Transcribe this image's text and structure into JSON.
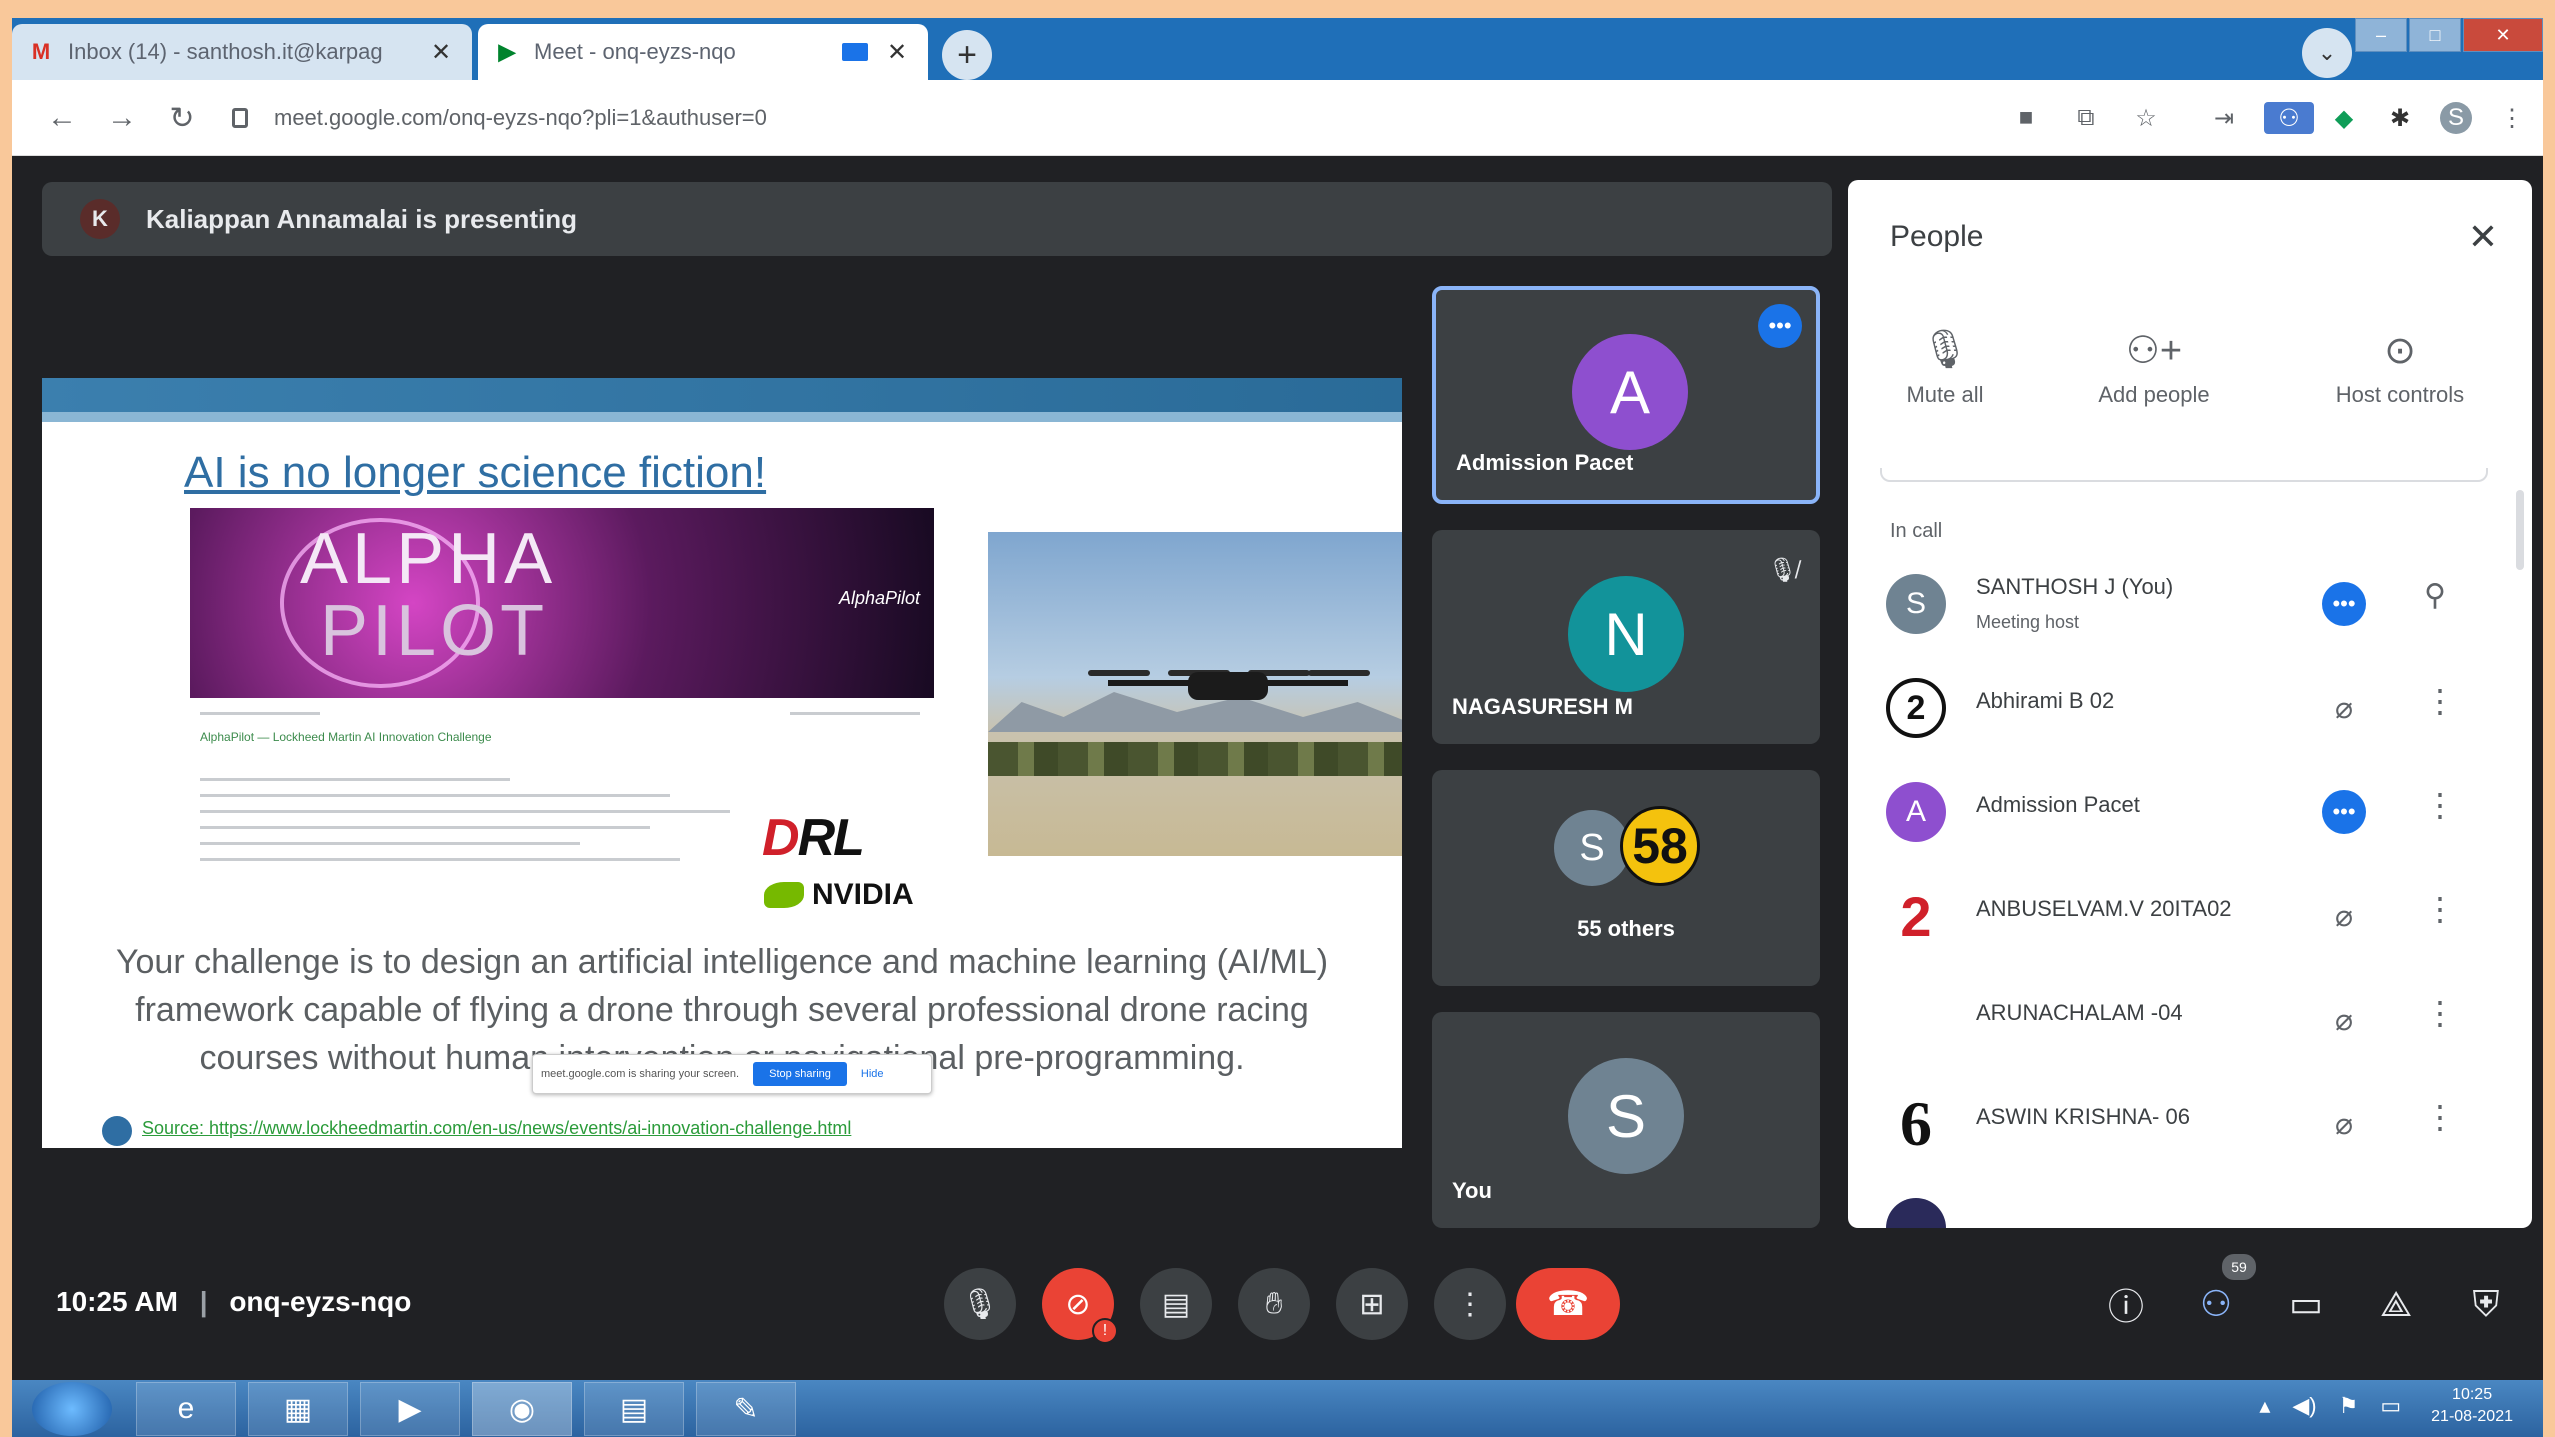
{
  "browser": {
    "tabs": [
      {
        "title": "Inbox (14) - santhosh.it@karpag",
        "favicon": "gmail-icon"
      },
      {
        "title": "Meet - onq-eyzs-nqo",
        "favicon": "meet-icon"
      }
    ],
    "url": "meet.google.com/onq-eyzs-nqo?pli=1&authuser=0"
  },
  "meet": {
    "presenter_initial": "K",
    "presenting_text": "Kaliappan Annamalai is presenting",
    "slide": {
      "title": "AI is no longer science fiction!",
      "alpha_line1": "ALPHA",
      "alpha_line2": "PILOT",
      "alpha_logo": "AlphaPilot",
      "article_heading": "AlphaPilot — Lockheed Martin AI Innovation Challenge",
      "drl_a": "D",
      "drl_b": "RL",
      "nvidia": "NVIDIA",
      "body": "Your challenge is to design an artificial intelligence and machine learning (AI/ML) framework capable of flying a drone through several professional drone racing courses without human intervention or navigational pre-programming.",
      "share_text": "meet.google.com is sharing your screen.",
      "stop_sharing": "Stop sharing",
      "hide": "Hide",
      "source": "Source: https://www.lockheedmartin.com/en-us/news/events/ai-innovation-challenge.html"
    },
    "tiles": [
      {
        "initial": "A",
        "name": "Admission Pacet",
        "color": "#8e4fcf"
      },
      {
        "initial": "N",
        "name": "NAGASURESH M",
        "color": "#12939a"
      },
      {
        "initial": "S",
        "badge": "58",
        "label": "55 others"
      },
      {
        "initial": "S",
        "name": "You",
        "color": "#6f8392"
      }
    ],
    "people": {
      "title": "People",
      "actions": [
        {
          "label": "Mute all",
          "icon": "mic-off-icon"
        },
        {
          "label": "Add people",
          "icon": "add-person-icon"
        },
        {
          "label": "Host controls",
          "icon": "host-controls-icon"
        }
      ],
      "section": "In call",
      "rows": [
        {
          "avatar": "S",
          "avatar_color": "#6f8392",
          "name": "SANTHOSH J (You)",
          "sub": "Meeting host",
          "status": "speaking"
        },
        {
          "avatar": "2",
          "avatar_color": "#ffffff",
          "name": "Abhirami B 02",
          "sub": "",
          "status": "muted"
        },
        {
          "avatar": "A",
          "avatar_color": "#8e4fcf",
          "name": "Admission Pacet",
          "sub": "",
          "status": "speaking"
        },
        {
          "avatar": "2",
          "avatar_color": "#ffffff",
          "name": "ANBUSELVAM.V 20ITA02",
          "sub": "",
          "status": "muted"
        },
        {
          "avatar": "",
          "avatar_color": "#ffffff",
          "name": "ARUNACHALAM -04",
          "sub": "",
          "status": "muted"
        },
        {
          "avatar": "6",
          "avatar_color": "#ffffff",
          "name": "ASWIN KRISHNA- 06",
          "sub": "",
          "status": "muted"
        }
      ]
    },
    "time": "10:25 AM",
    "meeting_code": "onq-eyzs-nqo",
    "chat_count": "59"
  },
  "taskbar": {
    "clock_time": "10:25",
    "clock_date": "21-08-2021"
  }
}
